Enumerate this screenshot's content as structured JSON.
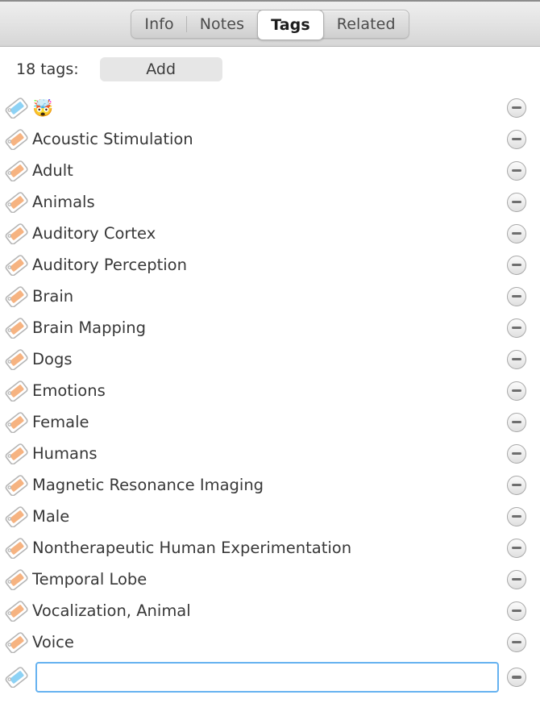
{
  "header": {
    "tabs": [
      {
        "label": "Info",
        "selected": false
      },
      {
        "label": "Notes",
        "selected": false
      },
      {
        "label": "Tags",
        "selected": true
      },
      {
        "label": "Related",
        "selected": false
      }
    ]
  },
  "toolbar": {
    "count_label": "18 tags:",
    "add_label": "Add"
  },
  "colors": {
    "tag_orange": "#f6b381",
    "tag_blue": "#8dd2f5",
    "tag_outline": "#b5b5b5",
    "input_focus": "#66b2f0",
    "selected_tab_bg": "#ffffff"
  },
  "tags": [
    {
      "label": "🤯",
      "icon": "tag-icon",
      "color": "blue",
      "remove_label": "Remove tag"
    },
    {
      "label": "Acoustic Stimulation",
      "icon": "tag-icon",
      "color": "orange",
      "remove_label": "Remove tag"
    },
    {
      "label": "Adult",
      "icon": "tag-icon",
      "color": "orange",
      "remove_label": "Remove tag"
    },
    {
      "label": "Animals",
      "icon": "tag-icon",
      "color": "orange",
      "remove_label": "Remove tag"
    },
    {
      "label": "Auditory Cortex",
      "icon": "tag-icon",
      "color": "orange",
      "remove_label": "Remove tag"
    },
    {
      "label": "Auditory Perception",
      "icon": "tag-icon",
      "color": "orange",
      "remove_label": "Remove tag"
    },
    {
      "label": "Brain",
      "icon": "tag-icon",
      "color": "orange",
      "remove_label": "Remove tag"
    },
    {
      "label": "Brain Mapping",
      "icon": "tag-icon",
      "color": "orange",
      "remove_label": "Remove tag"
    },
    {
      "label": "Dogs",
      "icon": "tag-icon",
      "color": "orange",
      "remove_label": "Remove tag"
    },
    {
      "label": "Emotions",
      "icon": "tag-icon",
      "color": "orange",
      "remove_label": "Remove tag"
    },
    {
      "label": "Female",
      "icon": "tag-icon",
      "color": "orange",
      "remove_label": "Remove tag"
    },
    {
      "label": "Humans",
      "icon": "tag-icon",
      "color": "orange",
      "remove_label": "Remove tag"
    },
    {
      "label": "Magnetic Resonance Imaging",
      "icon": "tag-icon",
      "color": "orange",
      "remove_label": "Remove tag"
    },
    {
      "label": "Male",
      "icon": "tag-icon",
      "color": "orange",
      "remove_label": "Remove tag"
    },
    {
      "label": "Nontherapeutic Human Experimentation",
      "icon": "tag-icon",
      "color": "orange",
      "remove_label": "Remove tag"
    },
    {
      "label": "Temporal Lobe",
      "icon": "tag-icon",
      "color": "orange",
      "remove_label": "Remove tag"
    },
    {
      "label": "Vocalization, Animal",
      "icon": "tag-icon",
      "color": "orange",
      "remove_label": "Remove tag"
    },
    {
      "label": "Voice",
      "icon": "tag-icon",
      "color": "orange",
      "remove_label": "Remove tag"
    }
  ],
  "new_tag_row": {
    "icon": "tag-icon",
    "color": "blue",
    "value": "",
    "placeholder": "",
    "remove_label": "Remove tag"
  }
}
